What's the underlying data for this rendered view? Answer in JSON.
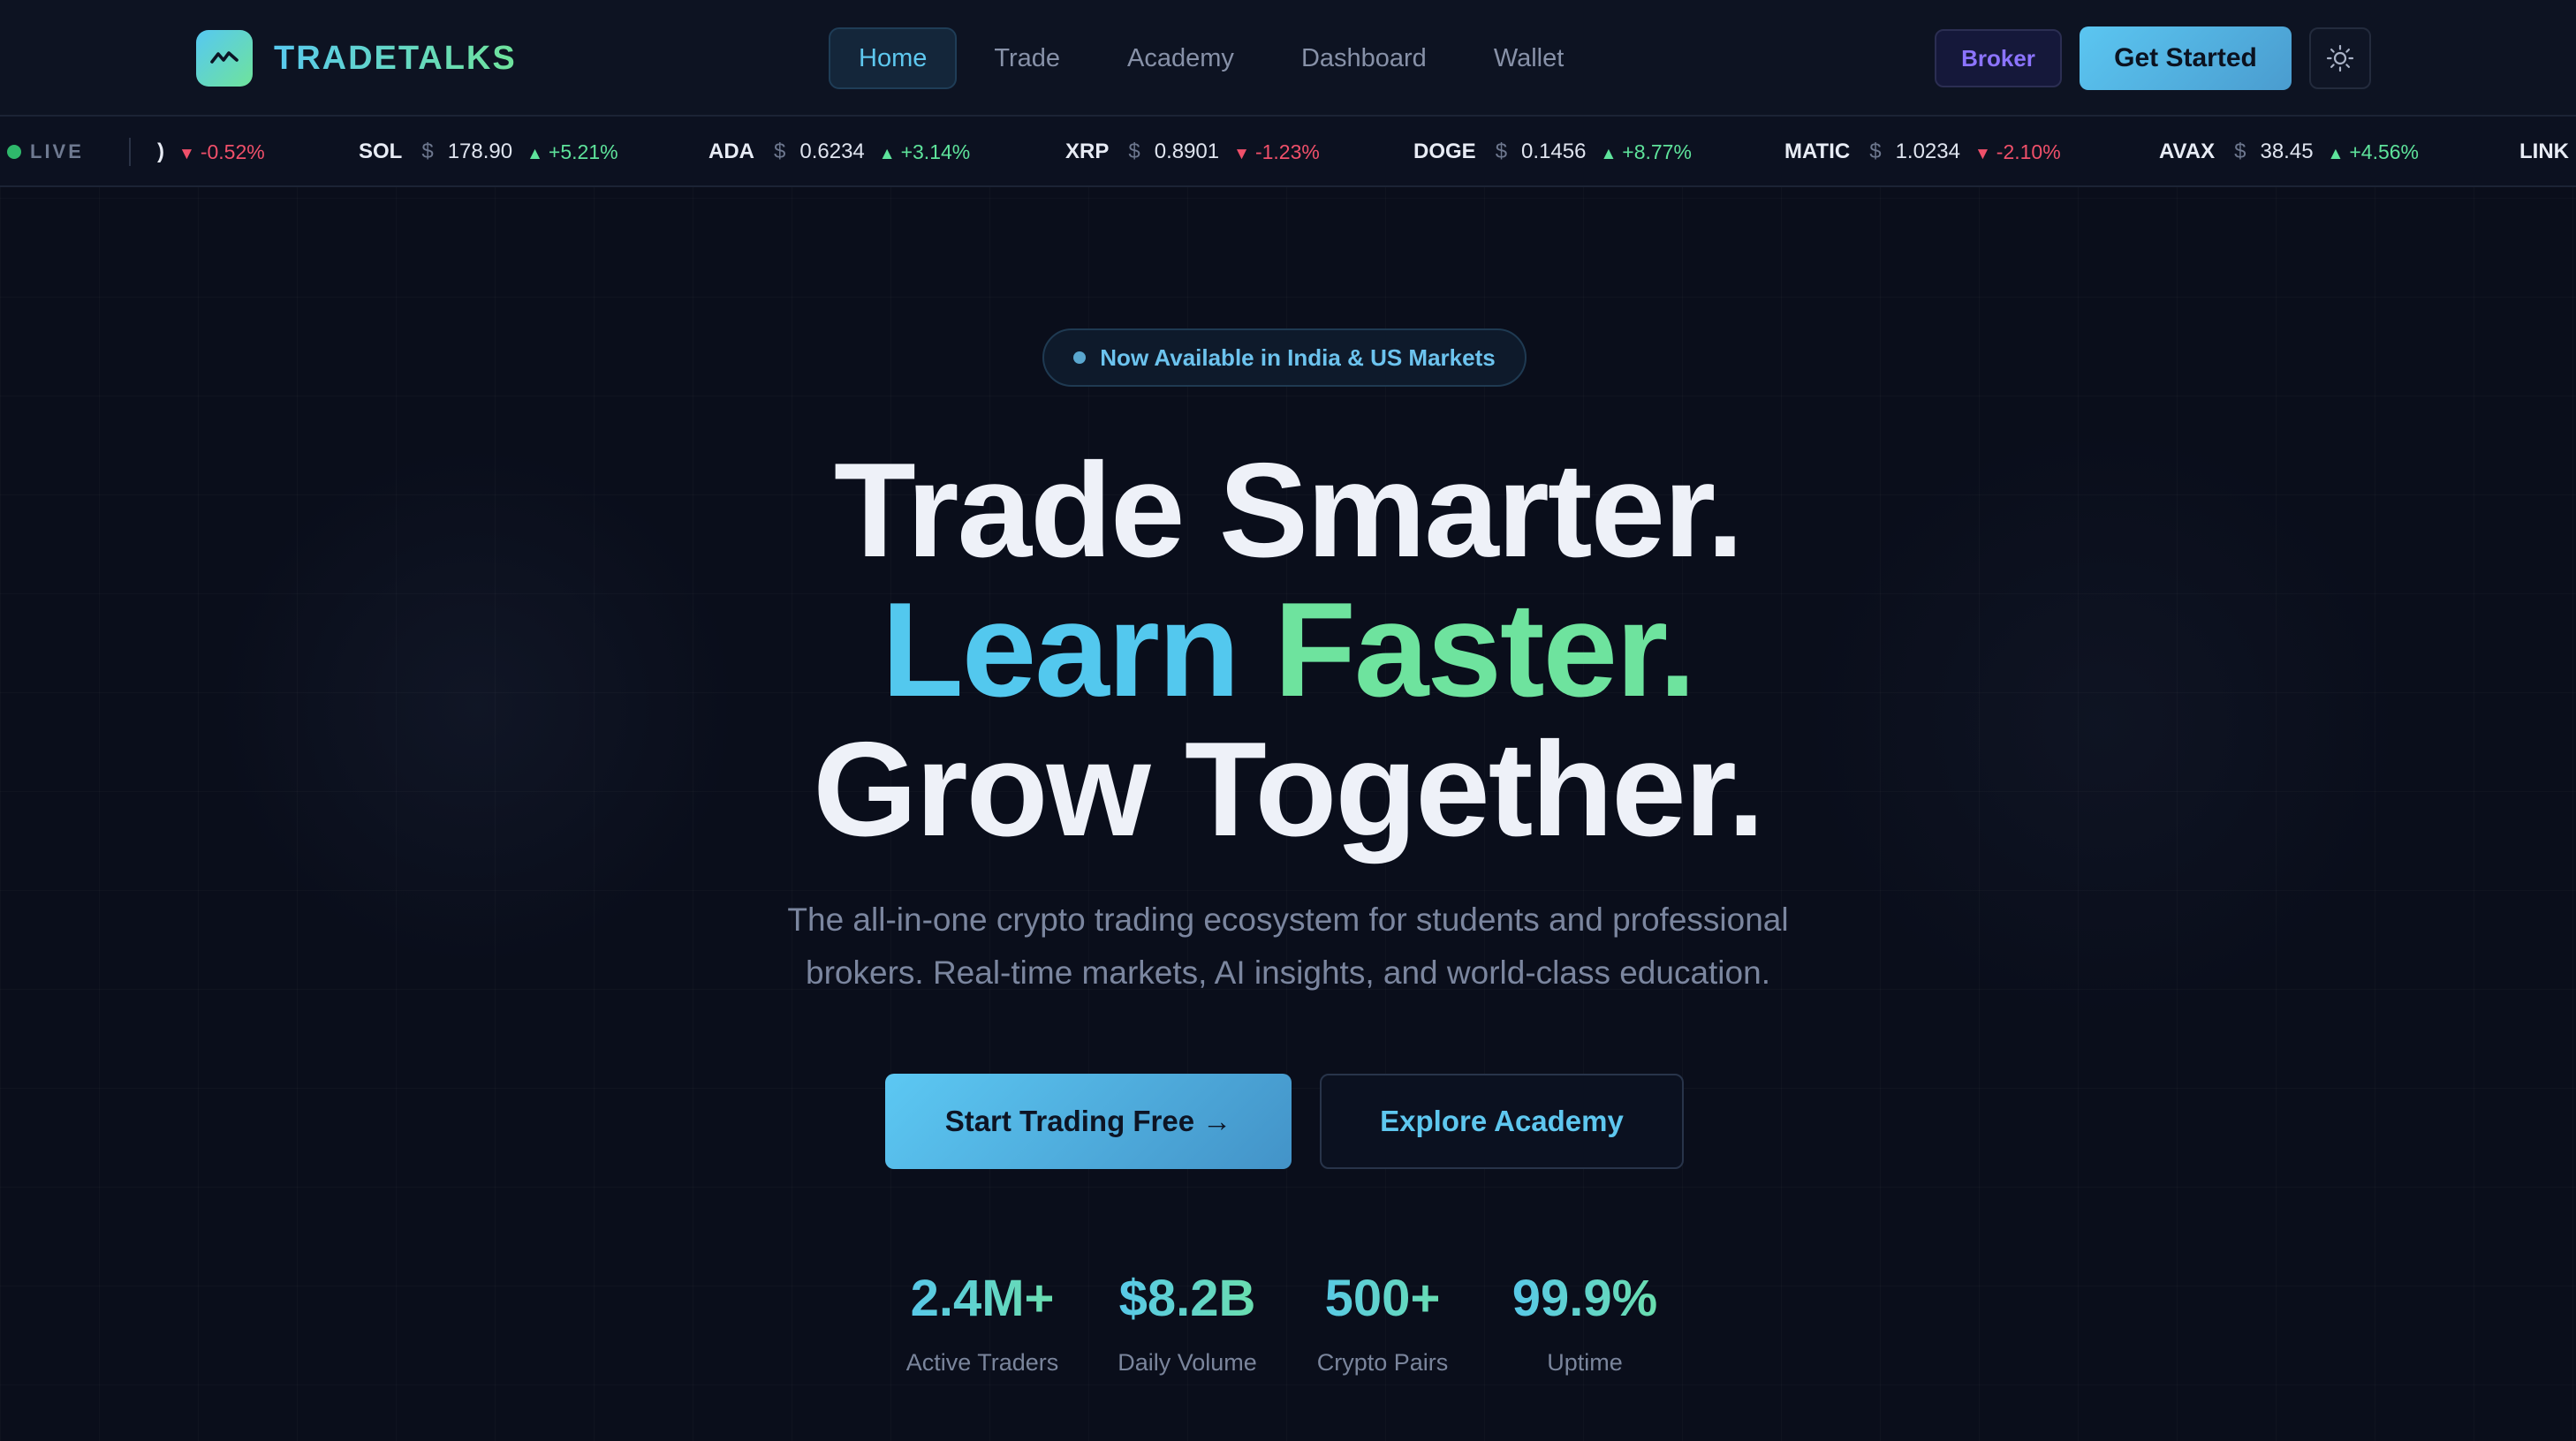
{
  "brand": {
    "name": "TRADETALKS",
    "logo_icon": "pulse-chart-icon",
    "accent_from": "#56c8f2",
    "accent_to": "#6fe39b"
  },
  "nav": {
    "links": [
      {
        "label": "Home",
        "active": true
      },
      {
        "label": "Trade",
        "active": false
      },
      {
        "label": "Academy",
        "active": false
      },
      {
        "label": "Dashboard",
        "active": false
      },
      {
        "label": "Wallet",
        "active": false
      }
    ],
    "broker_label": "Broker",
    "get_started_label": "Get Started",
    "theme_toggle_icon": "sun-icon"
  },
  "ticker": {
    "live_label": "LIVE",
    "items": [
      {
        "symbol": ")",
        "currency": "",
        "price": "",
        "change": "-0.52%",
        "direction": "down"
      },
      {
        "symbol": "SOL",
        "currency": "$",
        "price": "178.90",
        "change": "+5.21%",
        "direction": "up"
      },
      {
        "symbol": "ADA",
        "currency": "$",
        "price": "0.6234",
        "change": "+3.14%",
        "direction": "up"
      },
      {
        "symbol": "XRP",
        "currency": "$",
        "price": "0.8901",
        "change": "-1.23%",
        "direction": "down"
      },
      {
        "symbol": "DOGE",
        "currency": "$",
        "price": "0.1456",
        "change": "+8.77%",
        "direction": "up"
      },
      {
        "symbol": "MATIC",
        "currency": "$",
        "price": "1.0234",
        "change": "-2.10%",
        "direction": "down"
      },
      {
        "symbol": "AVAX",
        "currency": "$",
        "price": "38.45",
        "change": "+4.56%",
        "direction": "up"
      },
      {
        "symbol": "LINK",
        "currency": "",
        "price": "",
        "change": "",
        "direction": ""
      }
    ],
    "up_color": "#5ee39b",
    "down_color": "#f0506a"
  },
  "hero": {
    "badge": "Now Available in India & US Markets",
    "line1": "Trade Smarter.",
    "line2_a": "Learn",
    "line2_b": "Faster.",
    "line3": "Grow Together.",
    "subtitle": "The all-in-one crypto trading ecosystem for students and professional brokers. Real-time markets, AI insights, and world-class education.",
    "cta_primary": "Start Trading Free →",
    "cta_secondary": "Explore Academy"
  },
  "stats": [
    {
      "value": "2.4M+",
      "label": "Active Traders"
    },
    {
      "value": "$8.2B",
      "label": "Daily Volume"
    },
    {
      "value": "500+",
      "label": "Crypto Pairs"
    },
    {
      "value": "99.9%",
      "label": "Uptime"
    }
  ]
}
